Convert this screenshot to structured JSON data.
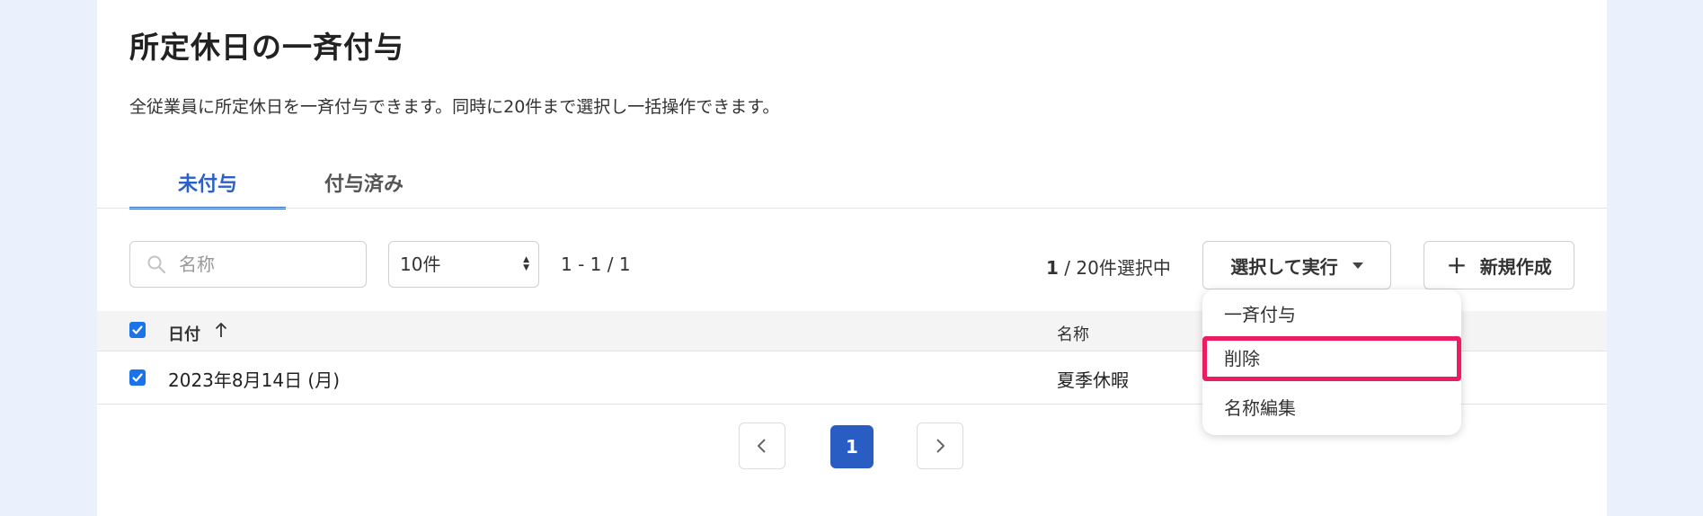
{
  "page": {
    "title": "所定休日の一斉付与",
    "description": "全従業員に所定休日を一斉付与できます。同時に20件まで選択し一括操作できます。"
  },
  "tabs": [
    {
      "label": "未付与",
      "active": true
    },
    {
      "label": "付与済み",
      "active": false
    }
  ],
  "toolbar": {
    "search_placeholder": "名称",
    "page_size": "10件",
    "range": "1 - 1 / 1",
    "selected_count": "1",
    "selected_suffix": " / 20件選択中",
    "run_label": "選択して実行",
    "new_label": "新規作成"
  },
  "table": {
    "headers": {
      "date": "日付",
      "name": "名称"
    },
    "rows": [
      {
        "date": "2023年8月14日 (月)",
        "name": "夏季休暇",
        "checked": true
      }
    ]
  },
  "pagination": {
    "current": "1"
  },
  "dropdown": {
    "items": [
      {
        "label": "一斉付与",
        "highlighted": false
      },
      {
        "label": "削除",
        "highlighted": true
      },
      {
        "label": "名称編集",
        "highlighted": false
      }
    ]
  },
  "colors": {
    "accent": "#2a60c7",
    "highlight": "#ec1c64",
    "checkbox": "#1a73e8",
    "background": "#eaf1fc"
  }
}
